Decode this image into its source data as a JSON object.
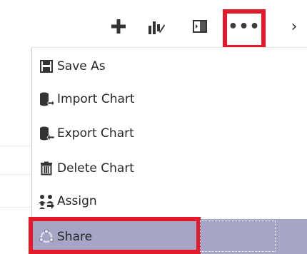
{
  "toolbar": {
    "buttons": [
      {
        "icon": "plus-icon"
      },
      {
        "icon": "chart-icon"
      },
      {
        "icon": "pane-icon"
      },
      {
        "icon": "more-icon",
        "label": "•••"
      },
      {
        "icon": "chevron-right-icon",
        "label": "›"
      }
    ]
  },
  "menu": {
    "items": [
      {
        "label": "Save As",
        "icon": "save-icon"
      },
      {
        "label": "Import Chart",
        "icon": "import-chart-icon"
      },
      {
        "label": "Export Chart",
        "icon": "export-chart-icon"
      },
      {
        "label": "Delete Chart",
        "icon": "trash-icon"
      },
      {
        "label": "Assign",
        "icon": "assign-users-icon"
      },
      {
        "label": "Share",
        "icon": "share-icon"
      }
    ]
  },
  "colors": {
    "highlight_red": "#e21b2a",
    "selected_row": "#a7a5c6",
    "text": "#262626"
  }
}
